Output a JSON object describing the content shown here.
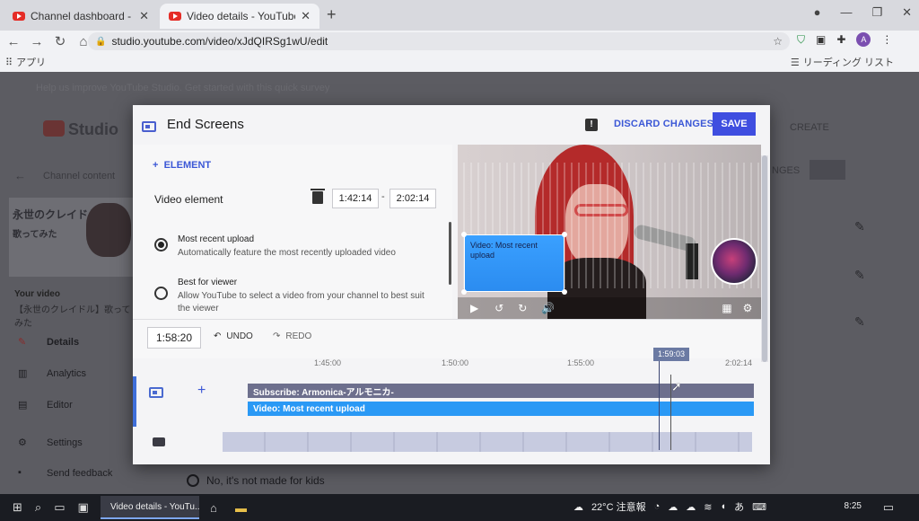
{
  "browser": {
    "tabs": [
      {
        "title": "Channel dashboard - YouTube St",
        "active": false
      },
      {
        "title": "Video details - YouTube Studio",
        "active": true
      }
    ],
    "new_tab": "+",
    "url": "studio.youtube.com/video/xJdQIRSg1wU/edit",
    "bookmarks_apps": "アプリ",
    "reading_list": "リーディング リスト",
    "profile_initial": "A"
  },
  "background": {
    "survey_text": "Help us improve YouTube Studio. Get started with this quick survey",
    "logo": "Studio",
    "channel_content": "Channel content",
    "thumb_title": "永世のクレイドル",
    "thumb_subtitle": "歌ってみた",
    "your_video": "Your video",
    "your_video_title": "【永世のクレイドル】歌ってみた",
    "nav": [
      {
        "label": "Details",
        "icon": "pencil-icon"
      },
      {
        "label": "Analytics",
        "icon": "analytics-icon"
      },
      {
        "label": "Editor",
        "icon": "film-icon"
      },
      {
        "label": "Settings",
        "icon": "gear-icon"
      },
      {
        "label": "Send feedback",
        "icon": "feedback-icon"
      }
    ],
    "create": "CREATE",
    "changes": "NGES",
    "kids_option": "No, it's not made for kids"
  },
  "modal": {
    "title": "End Screens",
    "discard": "DISCARD CHANGES",
    "save": "SAVE",
    "add_element": "ELEMENT",
    "video_element_label": "Video element",
    "start_time": "1:42:14",
    "end_time": "2:02:14",
    "time_separator": "-",
    "options": [
      {
        "title": "Most recent upload",
        "desc": "Automatically feature the most recently uploaded video",
        "selected": true
      },
      {
        "title": "Best for viewer",
        "desc": "Allow YouTube to select a video from your channel to best suit the viewer",
        "selected": false
      }
    ],
    "preview_element_label": "Video: Most recent upload",
    "current_time": "1:58:20",
    "undo": "UNDO",
    "redo": "REDO",
    "ruler_ticks": [
      "1:45:00",
      "1:50:00",
      "1:55:00",
      "2:02:14"
    ],
    "playhead_time": "1:59:03",
    "tracks": [
      {
        "label": "Subscribe: Armonica-アルモニカ-",
        "color": "#6d6f8d"
      },
      {
        "label": "Video: Most recent upload",
        "color": "#2a99f5"
      }
    ]
  },
  "taskbar": {
    "task_label": "Video details - YouTu...",
    "weather": "22°C 注意報",
    "time": "8:25"
  },
  "colors": {
    "accent": "#3f4ee0",
    "link": "#3b57d6",
    "video_bar": "#2a99f5",
    "subscribe_bar": "#6d6f8d"
  }
}
